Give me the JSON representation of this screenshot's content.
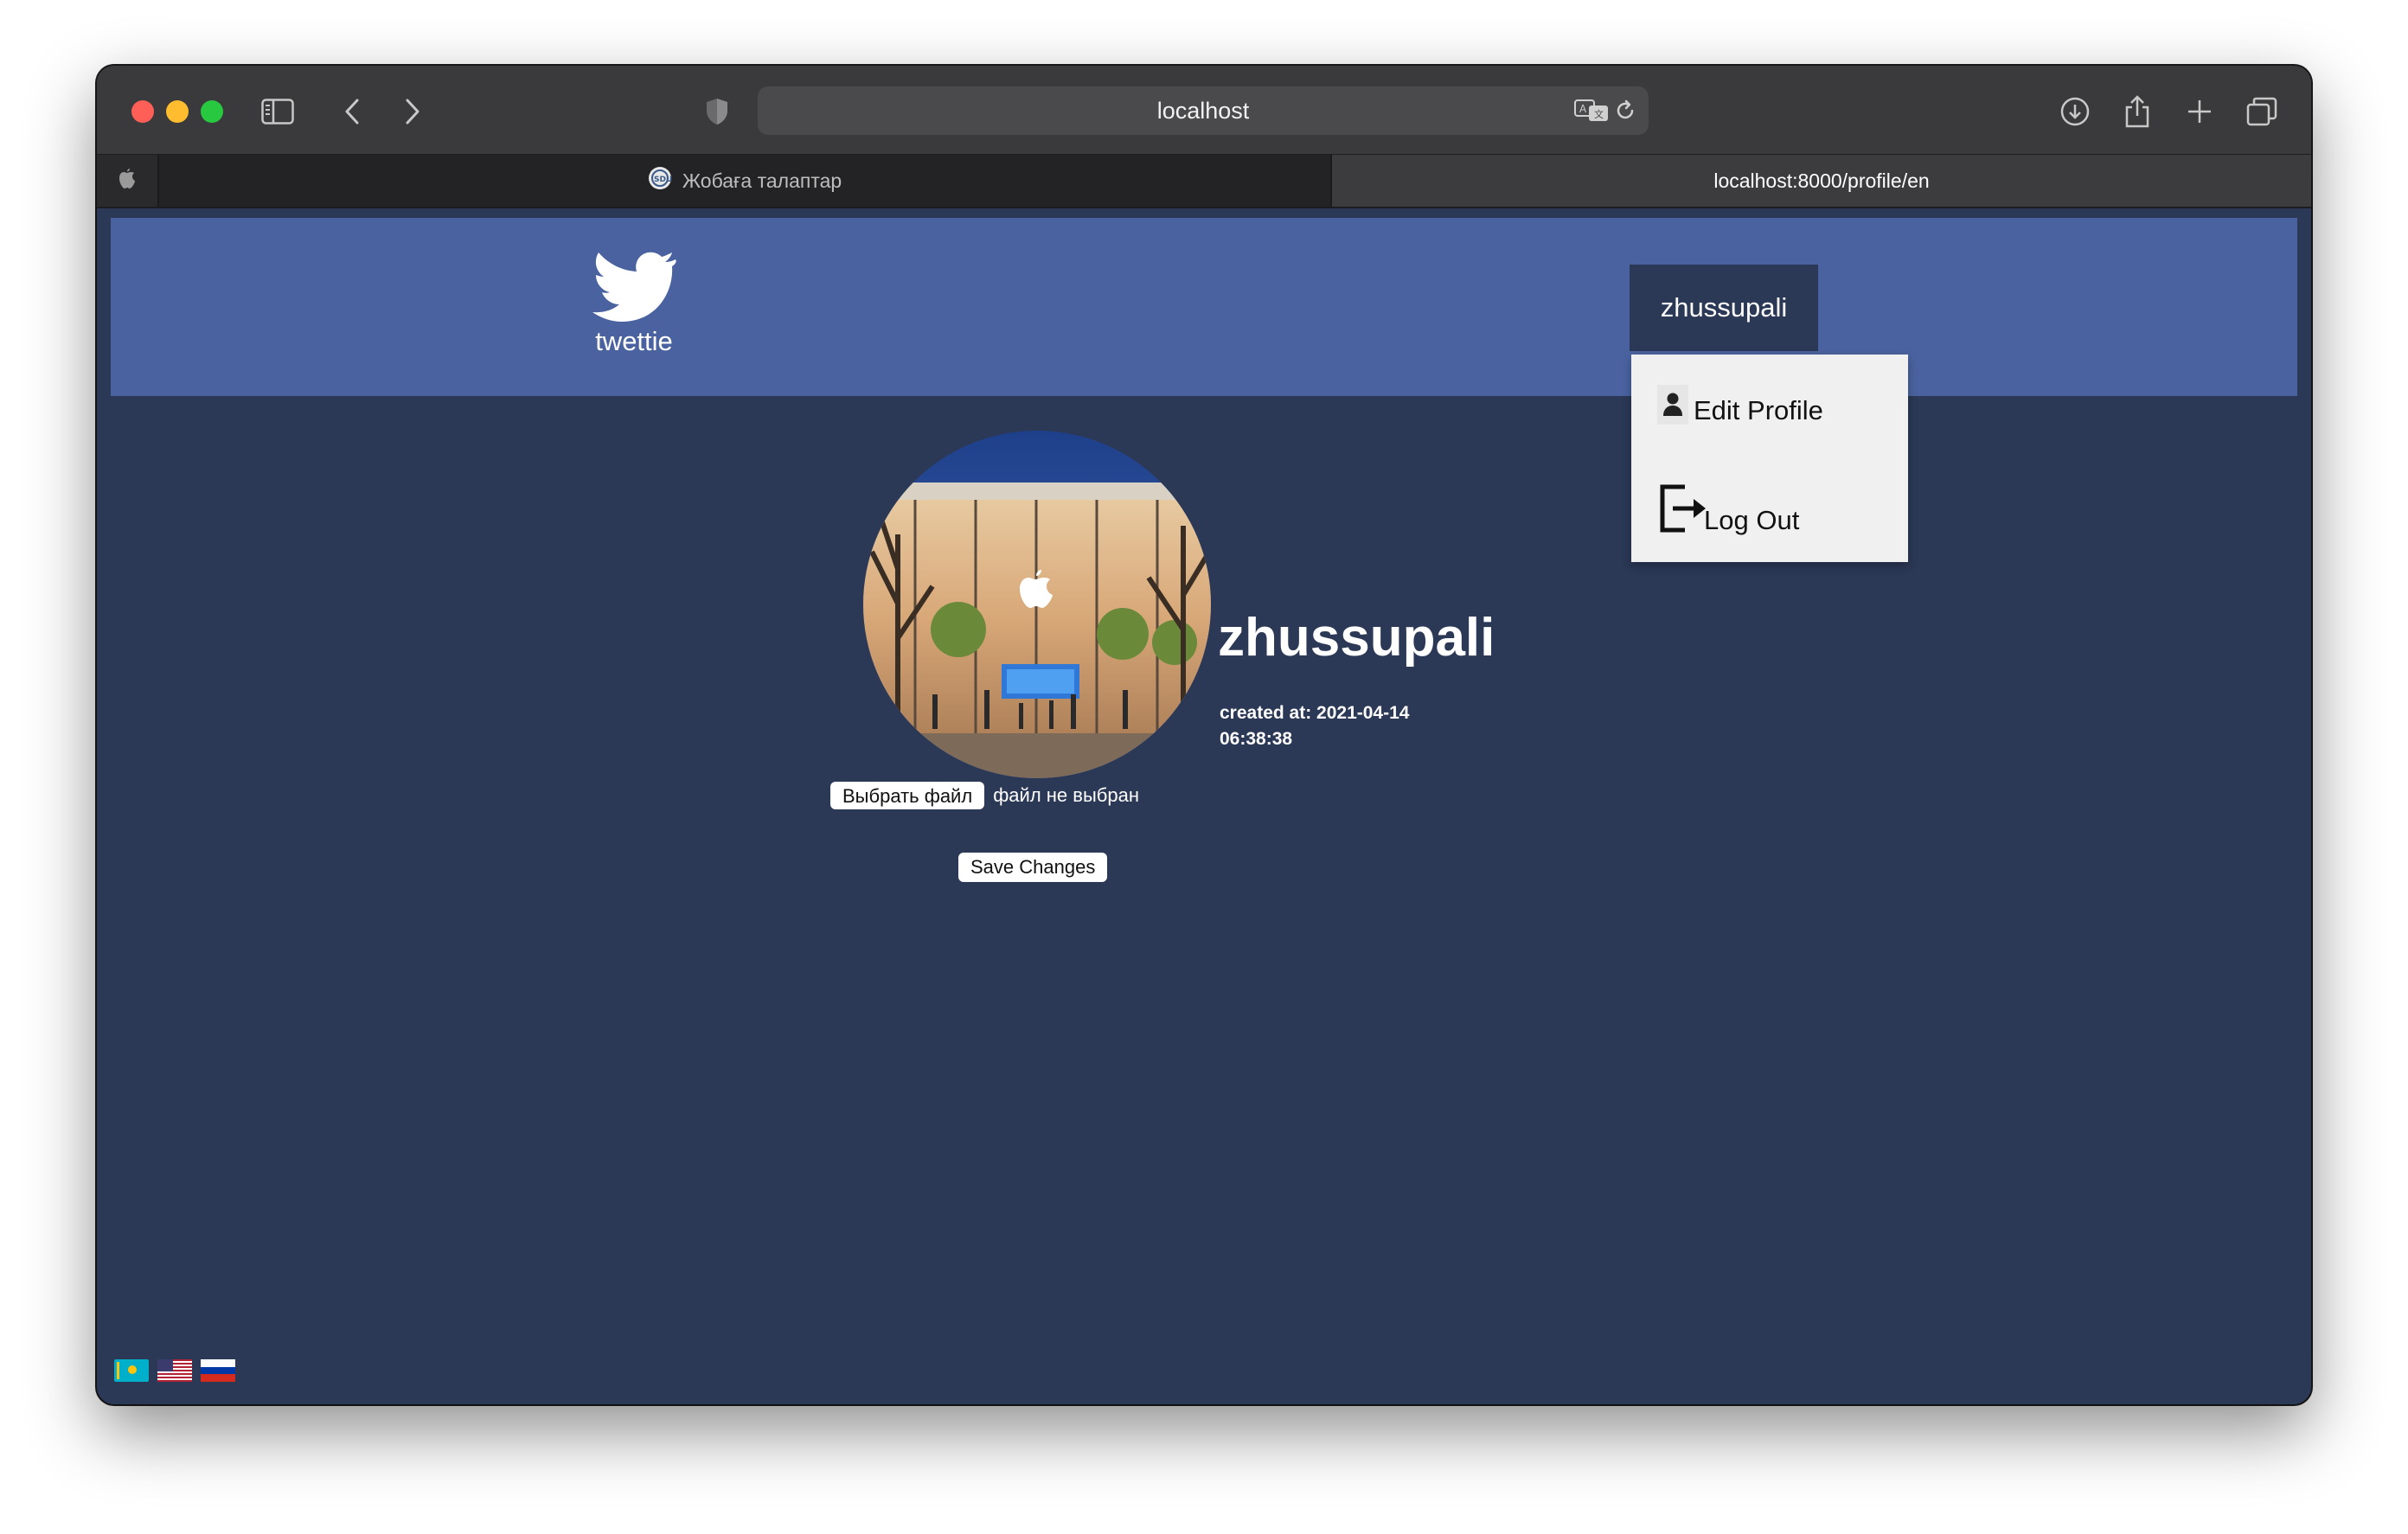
{
  "browser": {
    "address": "localhost",
    "tabs": [
      {
        "label": "Жобаға талаптар",
        "active": false
      },
      {
        "label": "localhost:8000/profile/en",
        "active": true
      }
    ]
  },
  "navbar": {
    "logo_text": "twettie",
    "user_button": "zhussupali",
    "menu": [
      {
        "label": "Edit Profile",
        "icon": "person-icon"
      },
      {
        "label": "Log Out",
        "icon": "logout-icon"
      }
    ]
  },
  "profile": {
    "choose_file_label": "Выбрать файл",
    "no_file_text": "файл не выбран",
    "save_button": "Save Changes",
    "username": "zhussupali",
    "created_at": "created at: 2021-04-14 06:38:38"
  },
  "languages": [
    {
      "icon": "flag-kazakhstan-icon",
      "color": "#00afca"
    },
    {
      "icon": "flag-usa-icon",
      "color": "#b22234"
    },
    {
      "icon": "flag-russia-icon",
      "color": "#d52b1e"
    }
  ],
  "colors": {
    "navbar": "#4a63a0",
    "page_background": "#2b3856",
    "dropdown": "#f0f0f0"
  }
}
